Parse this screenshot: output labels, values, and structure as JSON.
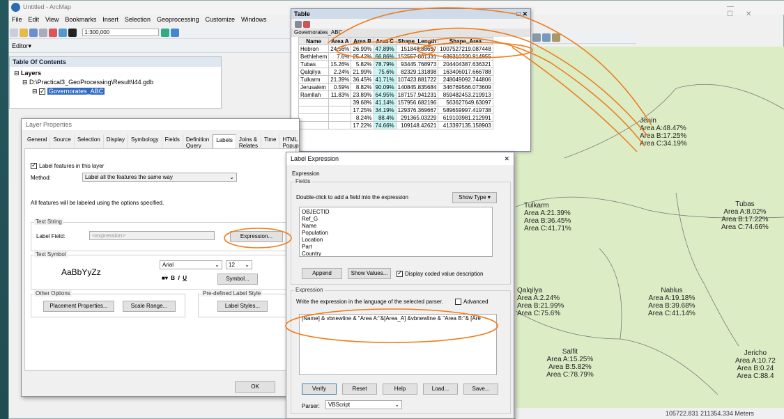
{
  "window": {
    "title": "Untitled - ArcMap"
  },
  "menu": [
    "File",
    "Edit",
    "View",
    "Bookmarks",
    "Insert",
    "Selection",
    "Geoprocessing",
    "Customize",
    "Windows"
  ],
  "toolbar": {
    "scale": "1:300,000",
    "editor": "Editor▾"
  },
  "toc": {
    "title": "Table Of Contents",
    "layers": "Layers",
    "gdb": "D:\\Practical3_GeoProcessing\\Result\\I44.gdb",
    "layer": "Governorates_ABC"
  },
  "table": {
    "title": "Table",
    "tab": "Governorates_ABC",
    "headers": [
      "Name",
      "Area A",
      "Area B",
      "Area C",
      "Shape_Length",
      "Shape_Area"
    ],
    "rows": [
      [
        "Hebron",
        "24.56%",
        "26.99%",
        "47.89%",
        "151848.88657",
        "1007527219.087448"
      ],
      [
        "Bethlehem",
        "7.6%",
        "25.42%",
        "66.86%",
        "152557.801331",
        "636310330.914955"
      ],
      [
        "Tubas",
        "15.26%",
        "5.82%",
        "78.79%",
        "93445.768973",
        "204404387.636321"
      ],
      [
        "Qalqilya",
        "2.24%",
        "21.99%",
        "75.6%",
        "82329.131898",
        "163406017.666788"
      ],
      [
        "Tulkarm",
        "21.39%",
        "36.45%",
        "41.71%",
        "107423.881722",
        "248049092.744806"
      ],
      [
        "Jerusalem",
        "0.59%",
        "8.82%",
        "90.09%",
        "140845.835684",
        "346769566.073609"
      ],
      [
        "Ramllah",
        "11.83%",
        "23.89%",
        "64.95%",
        "187157.941231",
        "859482453.219913"
      ],
      [
        "",
        "",
        "39.68%",
        "41.14%",
        "157956.682196",
        "563627649.63097"
      ],
      [
        "",
        "",
        "17.25%",
        "34.19%",
        "129376.369667",
        "589659997.419738"
      ],
      [
        "",
        "",
        "8.24%",
        "88.4%",
        "291365.03229",
        "619103981.212991"
      ],
      [
        "",
        "",
        "17.22%",
        "74.66%",
        "109148.42621",
        "413397135.158903"
      ]
    ]
  },
  "layer_props": {
    "title": "Layer Properties",
    "tabs": [
      "General",
      "Source",
      "Selection",
      "Display",
      "Symbology",
      "Fields",
      "Definition Query",
      "Labels",
      "Joins & Relates",
      "Time",
      "HTML Popup"
    ],
    "label_features": "Label features in this layer",
    "method_label": "Method:",
    "method_value": "Label all the features the same way",
    "all_features": "All features will be labeled using the options specified.",
    "text_string": "Text String",
    "label_field": "Label Field:",
    "label_field_value": "<expression>",
    "expression_btn": "Expression...",
    "text_symbol": "Text Symbol",
    "sample": "AaBbYyZz",
    "font": "Arial",
    "size": "12",
    "symbol_btn": "Symbol...",
    "other_options": "Other Options",
    "placement_btn": "Placement Properties...",
    "scale_btn": "Scale Range...",
    "predefined": "Pre-defined Label Style",
    "label_styles_btn": "Label Styles...",
    "ok": "OK"
  },
  "label_expr": {
    "title": "Label Expression",
    "expression_grp": "Expression",
    "fields_grp": "Fields",
    "dbl_click": "Double-click to add a field into the expression",
    "show_type": "Show Type",
    "fields": [
      "OBJECTID",
      "Ref_G",
      "Name",
      "Population",
      "Location",
      "Part",
      "Country"
    ],
    "append": "Append",
    "show_values": "Show Values...",
    "display_coded": "Display coded value description",
    "expr_grp": "Expression",
    "write_text": "Write the expression in the language of the selected parser.",
    "advanced": "Advanced",
    "expression": "[Name] & vbnewline & \"Area A:\"&[Area_A] &vbnewline &  \"Area B:\"& [Are",
    "verify": "Verify",
    "reset": "Reset",
    "help": "Help",
    "load": "Load...",
    "save": "Save...",
    "parser_label": "Parser:",
    "parser": "VBScript"
  },
  "map": {
    "labels": [
      {
        "text": "Jenin\nArea A:48.47%\nArea B:17.25%\nArea C:34.19%"
      },
      {
        "text": "Tulkarm\nArea A:21.39%\nArea B:36.45%\nArea C:41.71%"
      },
      {
        "text": "Tubas\nArea A:8.02%\nArea B:17.22%\nArea C:74.66%"
      },
      {
        "text": "Qalqilya\nArea A:2.24%\nArea B:21.99%\nArea C:75.6%"
      },
      {
        "text": "Nablus\nArea A:19.18%\nArea B:39.68%\nArea C:41.14%"
      },
      {
        "text": "Salfit\nArea A:15.25%\nArea B:5.82%\nArea C:78.79%"
      },
      {
        "text": "Jericho\nArea A:10.72\nArea B:0.24\nArea C:88.4"
      }
    ],
    "status": "105722.831  211354.334 Meters"
  },
  "colors": {
    "annotation": "#f07c1c",
    "map": "#dcedc6",
    "highlight": "#c9f7f7"
  }
}
